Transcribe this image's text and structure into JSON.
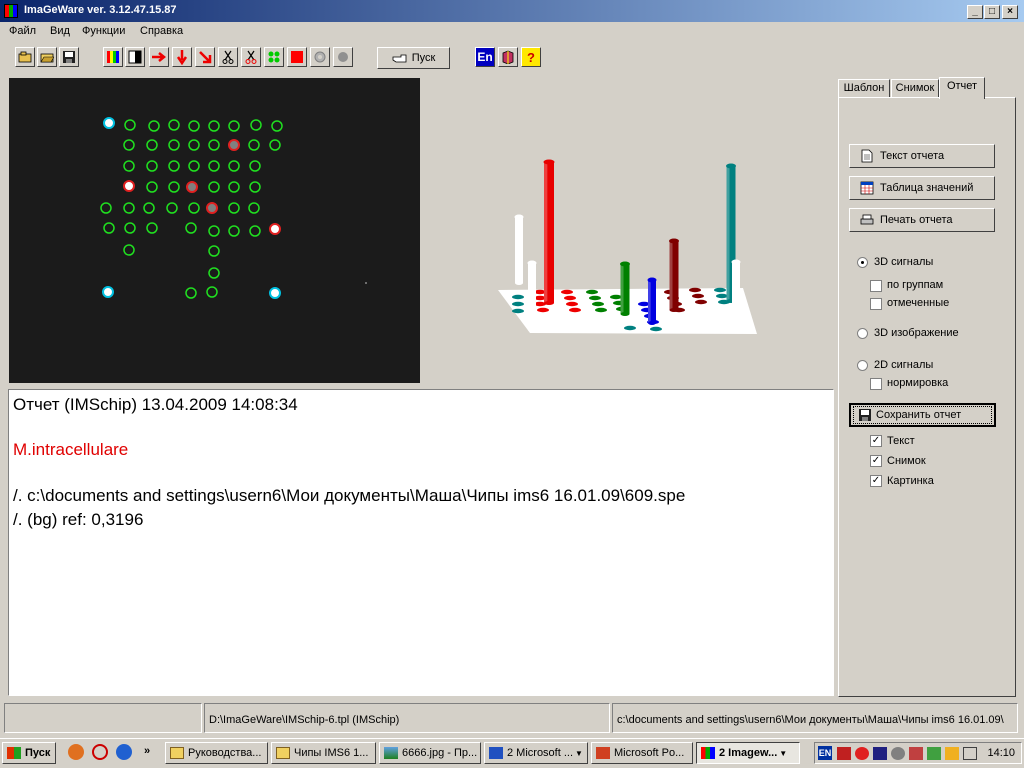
{
  "window": {
    "title": "ImaGeWare ver. 3.12.47.15.87"
  },
  "menu": [
    "Файл",
    "Вид",
    "Функции",
    "Справка"
  ],
  "toolbar": {
    "start_label": "Пуск",
    "lang_label": "En"
  },
  "tabs": [
    "Шаблон",
    "Снимок",
    "Отчет"
  ],
  "active_tab": "Отчет",
  "right_panel": {
    "btn_text": "Текст отчета",
    "btn_table": "Таблица значений",
    "btn_print": "Печать отчета",
    "radio_3d_signals": "3D сигналы",
    "chk_groups": "по группам",
    "chk_marked": "отмеченные",
    "radio_3d_image": "3D изображение",
    "radio_2d_signals": "2D сигналы",
    "chk_normalize": "нормировка",
    "btn_save": "Сохранить отчет",
    "chk_text": "Текст",
    "chk_snapshot": "Снимок",
    "chk_picture": "Картинка"
  },
  "report": {
    "header": "Отчет  (IMSchip) 13.04.2009 14:08:34",
    "organism": "M.intracellulare",
    "path_line": "/. c:\\documents and settings\\usern6\\Мои документы\\Маша\\Чипы ims6 16.01.09\\609.spe",
    "ref_line": "/. (bg)  ref: 0,3196",
    "organism_color": "#e00000"
  },
  "status": {
    "left": "",
    "middle": "D:\\ImaGeWare\\IMSchip-6.tpl (IMSchip)",
    "right": "c:\\documents and settings\\usern6\\Мои документы\\Маша\\Чипы ims6 16.01.09\\"
  },
  "taskbar": {
    "start": "Пуск",
    "tasks": [
      "Руководства...",
      "Чипы IMS6 1...",
      "6666.jpg - Пр...",
      "2 Microsoft ...",
      "Microsoft Po...",
      "2 Imagew..."
    ],
    "clock": "14:10",
    "tray_lang": "EN"
  }
}
